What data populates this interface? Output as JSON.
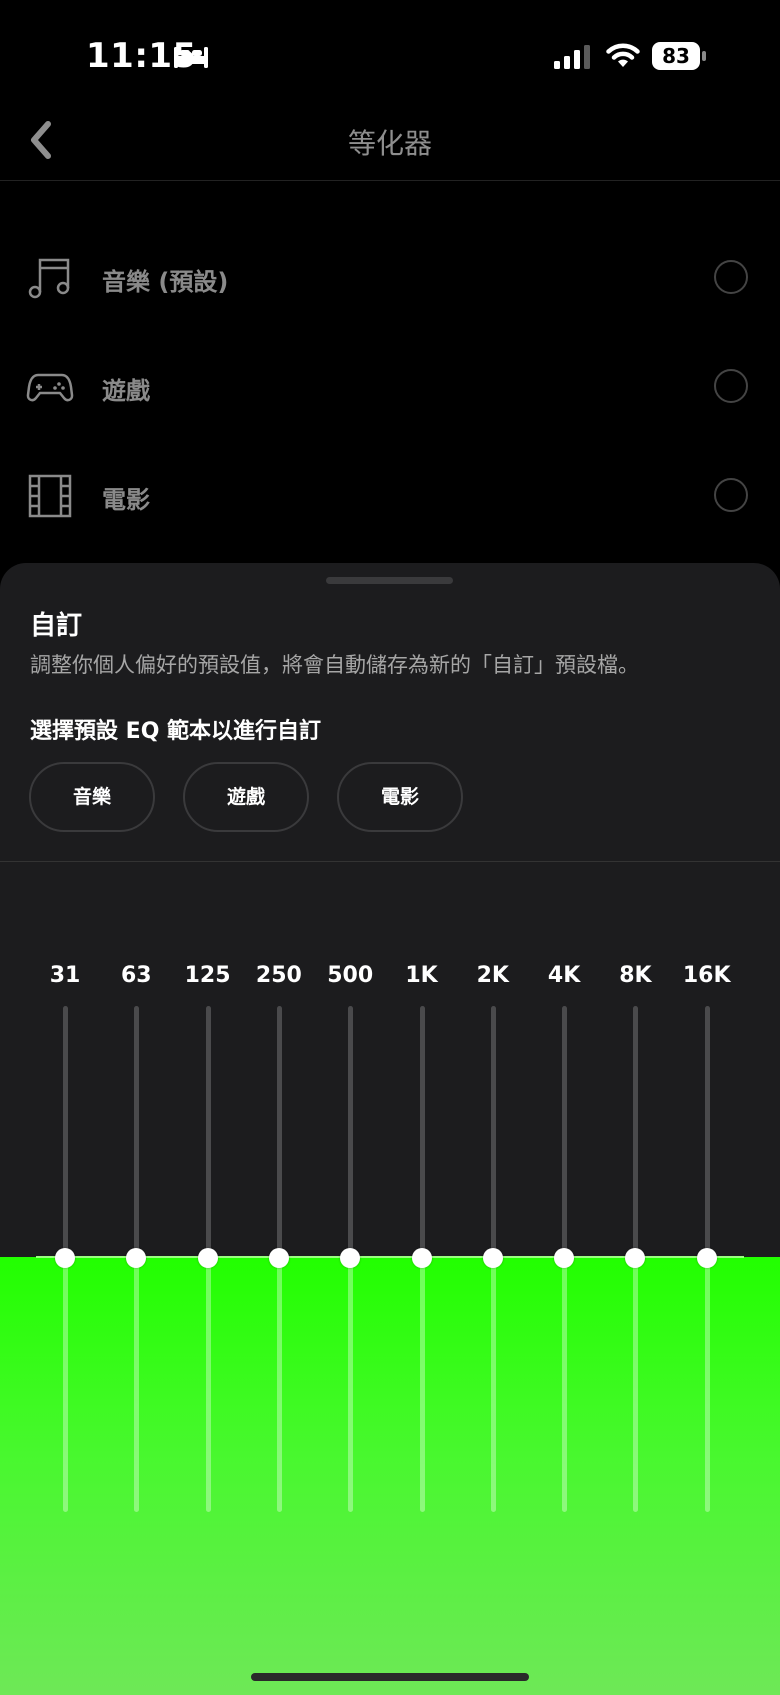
{
  "status_bar": {
    "time": "11:15",
    "battery": "83",
    "icons": [
      "bed-icon",
      "cellular-signal-icon",
      "wifi-icon",
      "battery-icon"
    ]
  },
  "nav": {
    "title": "等化器",
    "back_icon": "chevron-left-icon"
  },
  "presets": [
    {
      "label": "音樂 (預設)",
      "icon": "music-note-icon"
    },
    {
      "label": "遊戲",
      "icon": "gamepad-icon"
    },
    {
      "label": "電影",
      "icon": "film-icon"
    }
  ],
  "sheet": {
    "title": "自訂",
    "description": "調整你個人偏好的預設值，將會自動儲存為新的「自訂」預設檔。",
    "subtitle": "選擇預設 EQ 範本以進行自訂",
    "chips": [
      "音樂",
      "遊戲",
      "電影"
    ]
  },
  "eq": {
    "bands": [
      "31",
      "63",
      "125",
      "250",
      "500",
      "1K",
      "2K",
      "4K",
      "8K",
      "16K"
    ],
    "levels": [
      0.5,
      0.5,
      0.5,
      0.5,
      0.5,
      0.5,
      0.5,
      0.5,
      0.5,
      0.5
    ],
    "fill_color": "#22ff00"
  },
  "colors": {
    "background": "#000000",
    "sheet": "#1c1c1e",
    "accent": "#22ff00"
  }
}
